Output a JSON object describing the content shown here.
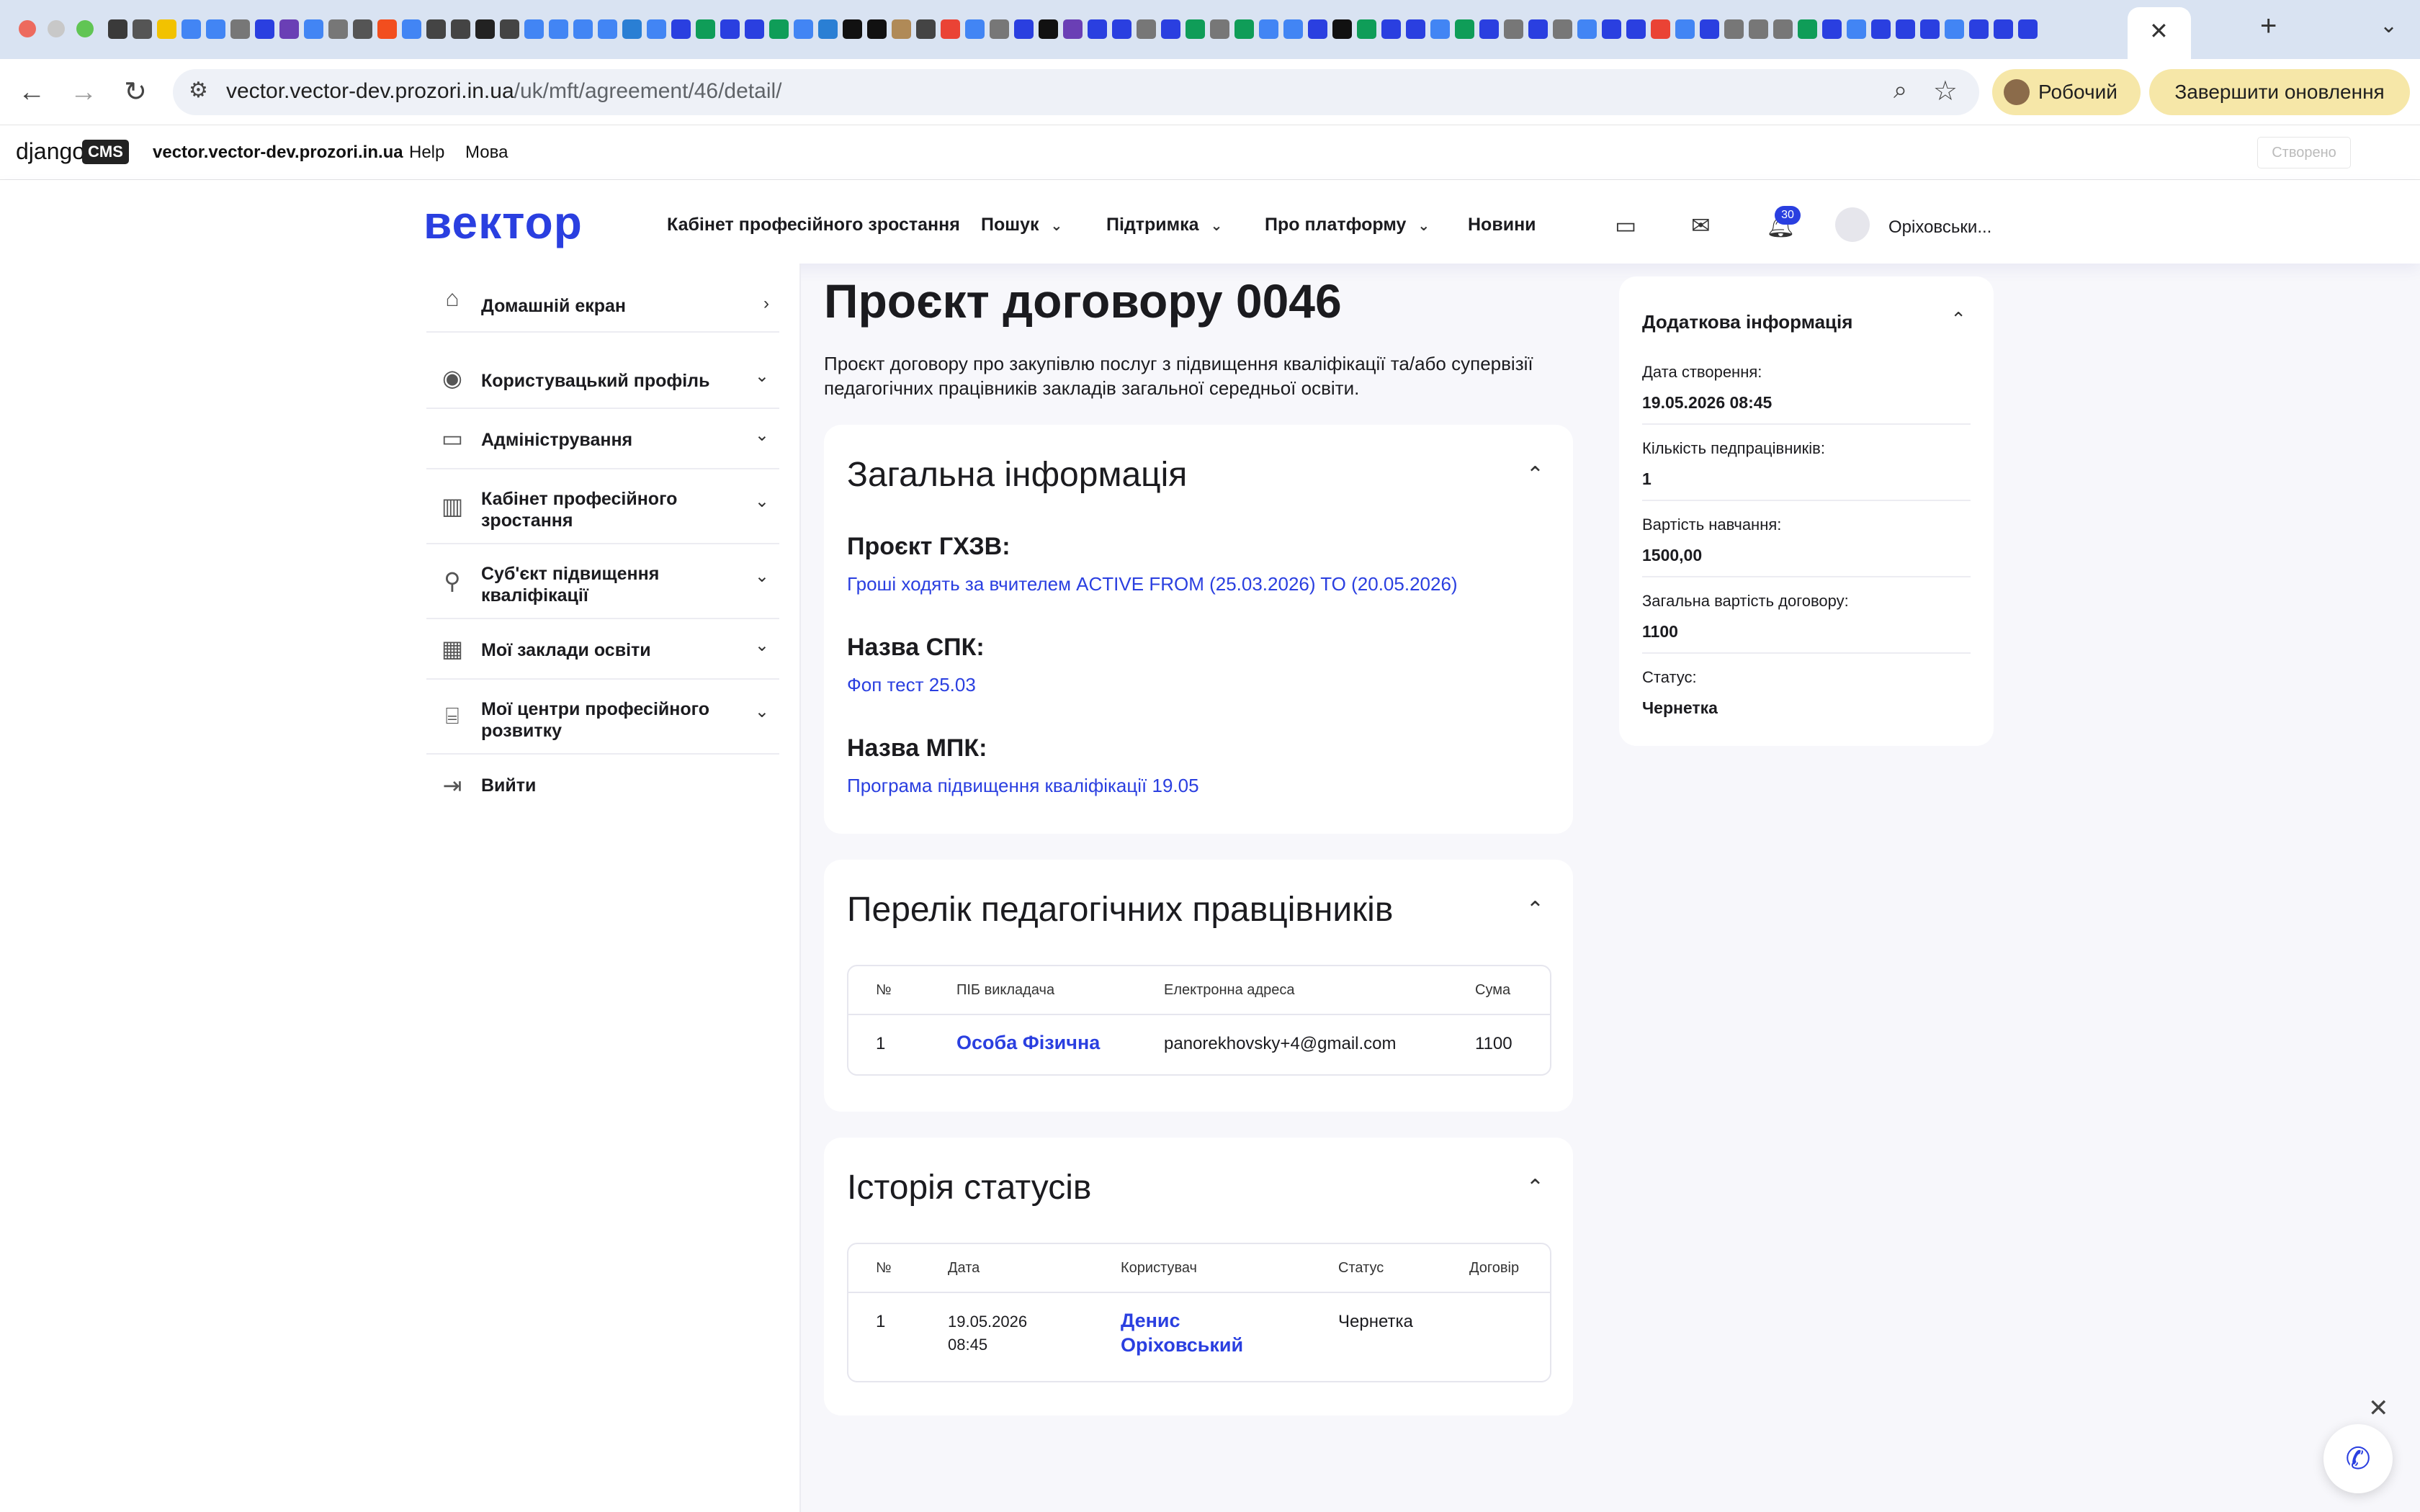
{
  "browser": {
    "url_host": "vector.vector-dev.prozori.in.ua",
    "url_path": "/uk/mft/agreement/46/detail/",
    "profile_label": "Робочий",
    "update_label": "Завершити оновлення",
    "tab_colors": [
      "#3a3a3a",
      "#555555",
      "#f2c200",
      "#4285f4",
      "#4285f4",
      "#777777",
      "#2a3fe0",
      "#6a3fb5",
      "#4285f4",
      "#777777",
      "#555555",
      "#f24e1e",
      "#4285f4",
      "#444444",
      "#444444",
      "#222222",
      "#444444",
      "#4285f4",
      "#4285f4",
      "#4285f4",
      "#4285f4",
      "#2a7fd4",
      "#4285f4",
      "#2a3fe0",
      "#0f9d58",
      "#2a3fe0",
      "#2a3fe0",
      "#0f9d58",
      "#4285f4",
      "#2a7fd4",
      "#111111",
      "#111111",
      "#b08a57",
      "#444444",
      "#ea4335",
      "#4285f4",
      "#777777",
      "#2a3fe0",
      "#111111",
      "#6a3fb5",
      "#2a3fe0",
      "#2a3fe0",
      "#777777",
      "#2a3fe0",
      "#0f9d58",
      "#777777",
      "#0f9d58",
      "#4285f4",
      "#4285f4",
      "#2a3fe0",
      "#111111",
      "#0f9d58",
      "#2a3fe0",
      "#2a3fe0",
      "#4285f4",
      "#0f9d58",
      "#2a3fe0",
      "#777777",
      "#2a3fe0",
      "#777777",
      "#4285f4",
      "#2a3fe0",
      "#2a3fe0",
      "#ea4335",
      "#4285f4",
      "#2a3fe0",
      "#777777",
      "#777777",
      "#777777",
      "#0f9d58",
      "#2a3fe0",
      "#4285f4",
      "#2a3fe0",
      "#2a3fe0",
      "#2a3fe0",
      "#4285f4",
      "#2a3fe0",
      "#2a3fe0",
      "#2a3fe0"
    ]
  },
  "cms": {
    "logo": "django",
    "badge": "CMS",
    "site": "vector.vector-dev.prozori.in.ua",
    "help": "Help",
    "language": "Мова",
    "created": "Створено"
  },
  "header": {
    "logo": "вектор",
    "nav": [
      {
        "label": "Кабінет професійного зростання"
      },
      {
        "label": "Пошук"
      },
      {
        "label": "Підтримка"
      },
      {
        "label": "Про платформу"
      },
      {
        "label": "Новини"
      }
    ],
    "notifications_count": "30",
    "user_name": "Оріховськи..."
  },
  "sidebar": {
    "items": [
      {
        "label": "Домашній екран",
        "icon": "home-icon"
      },
      {
        "label": "Користувацький профіль",
        "icon": "user-circle-icon"
      },
      {
        "label": "Адміністрування",
        "icon": "laptop-icon"
      },
      {
        "label": "Кабінет професійного зростання",
        "icon": "chart-icon"
      },
      {
        "label": "Суб'єкт підвищення кваліфікації",
        "icon": "user-arrow-icon"
      },
      {
        "label": "Мої заклади освіти",
        "icon": "building-icon"
      },
      {
        "label": "Мої центри професійного розвитку",
        "icon": "bank-icon"
      },
      {
        "label": "Вийти",
        "icon": "logout-icon"
      }
    ]
  },
  "main": {
    "title": "Проєкт договору 0046",
    "description": "Проєкт договору про закупівлю послуг з підвищення кваліфікації та/або супервізії педагогічних працівників закладів загальної середньої освіти.",
    "general": {
      "title": "Загальна інформація",
      "fields": [
        {
          "label": "Проєкт ГХЗВ:",
          "value": "Гроші ходять за вчителем ACTIVE FROM (25.03.2026) TO (20.05.2026)"
        },
        {
          "label": "Назва СПК:",
          "value": "Фоп тест 25.03"
        },
        {
          "label": "Назва МПК:",
          "value": "Програма підвищення кваліфікації 19.05"
        }
      ]
    },
    "workers": {
      "title": "Перелік педагогічних правцівників",
      "columns": [
        "№",
        "ПІБ викладача",
        "Електронна адреса",
        "Сума"
      ],
      "rows": [
        {
          "num": "1",
          "name": "Особа Фізична",
          "email": "panorekhovsky+4@gmail.com",
          "sum": "1100"
        }
      ]
    },
    "history": {
      "title": "Історія статусів",
      "columns": [
        "№",
        "Дата",
        "Користувач",
        "Статус",
        "Договір"
      ],
      "rows": [
        {
          "num": "1",
          "date": "19.05.2026",
          "time": "08:45",
          "user_first": "Денис",
          "user_last": "Оріховський",
          "status": "Чернетка",
          "contract": ""
        }
      ]
    }
  },
  "info": {
    "title": "Додаткова інформація",
    "rows": [
      {
        "label": "Дата створення:",
        "value": "19.05.2026 08:45"
      },
      {
        "label": "Кількість педпрацівників:",
        "value": "1"
      },
      {
        "label": "Вартість навчання:",
        "value": "1500,00"
      },
      {
        "label": "Загальна вартість договору:",
        "value": "1100"
      },
      {
        "label": "Статус:",
        "value": "Чернетка"
      }
    ]
  }
}
